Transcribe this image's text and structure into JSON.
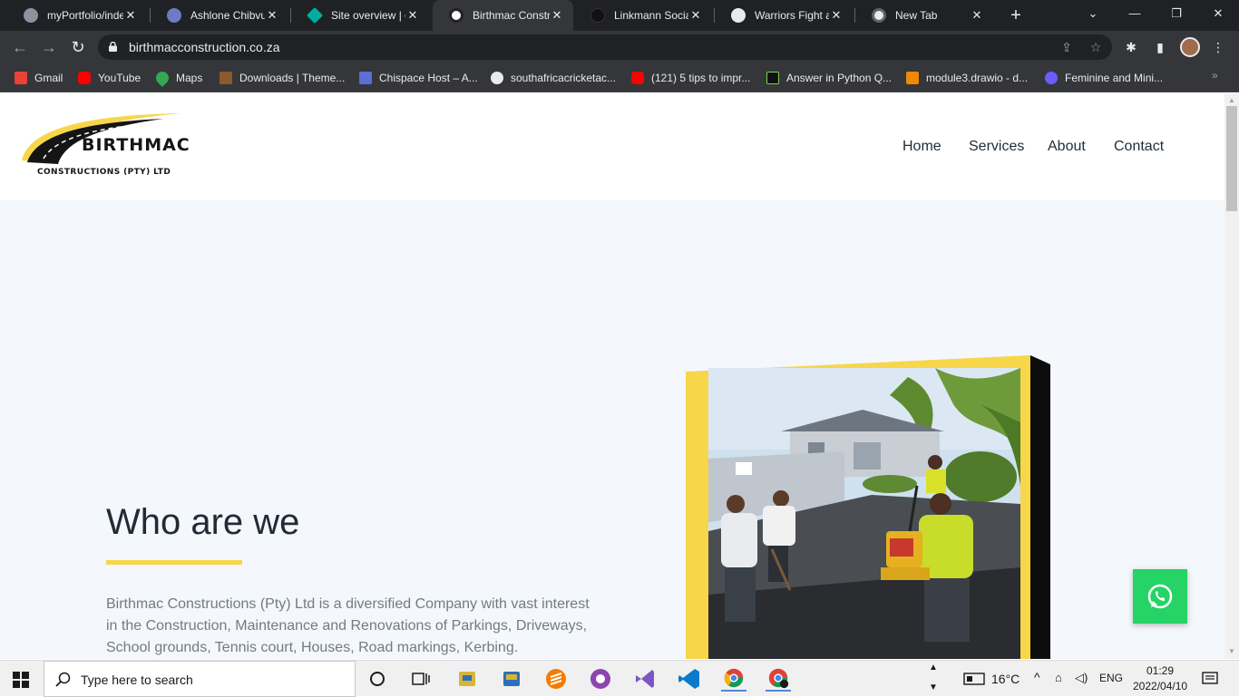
{
  "browser": {
    "tabs": [
      {
        "title": "myPortfolio/index",
        "active": false
      },
      {
        "title": "Ashlone Chibvuri",
        "active": false
      },
      {
        "title": "Site overview | dr",
        "active": false
      },
      {
        "title": "Birthmac Constru",
        "active": true
      },
      {
        "title": "Linkmann Social",
        "active": false
      },
      {
        "title": "Warriors Fight an",
        "active": false
      },
      {
        "title": "New Tab",
        "active": false
      }
    ],
    "url": "birthmacconstruction.co.za",
    "bookmarks": [
      {
        "label": "Gmail"
      },
      {
        "label": "YouTube"
      },
      {
        "label": "Maps"
      },
      {
        "label": "Downloads | Theme..."
      },
      {
        "label": "Chispace Host – A..."
      },
      {
        "label": "southafricacricketac..."
      },
      {
        "label": "(121) 5 tips to impr..."
      },
      {
        "label": "Answer in Python Q..."
      },
      {
        "label": "module3.drawio - d..."
      },
      {
        "label": "Feminine and Mini..."
      }
    ]
  },
  "site": {
    "logo": {
      "name": "BIRTHMAC",
      "sub": "CONSTRUCTIONS (PTY) LTD"
    },
    "nav": [
      "Home",
      "Services",
      "About",
      "Contact"
    ],
    "hero": {
      "title": "Who are we",
      "body": "Birthmac Constructions (Pty) Ltd is a diversified Company with vast interest in the Construction, Maintenance and Renovations of Parkings, Driveways, School grounds, Tennis court, Houses, Road markings, Kerbing."
    }
  },
  "taskbar": {
    "search_placeholder": "Type here to search",
    "weather": "16°C",
    "language": "ENG",
    "time": "01:29",
    "date": "2022/04/10"
  },
  "colors": {
    "accent_yellow": "#f7d64a",
    "whatsapp_green": "#25d366",
    "page_bg": "#f4f7fc",
    "chrome_dark": "#202124"
  }
}
